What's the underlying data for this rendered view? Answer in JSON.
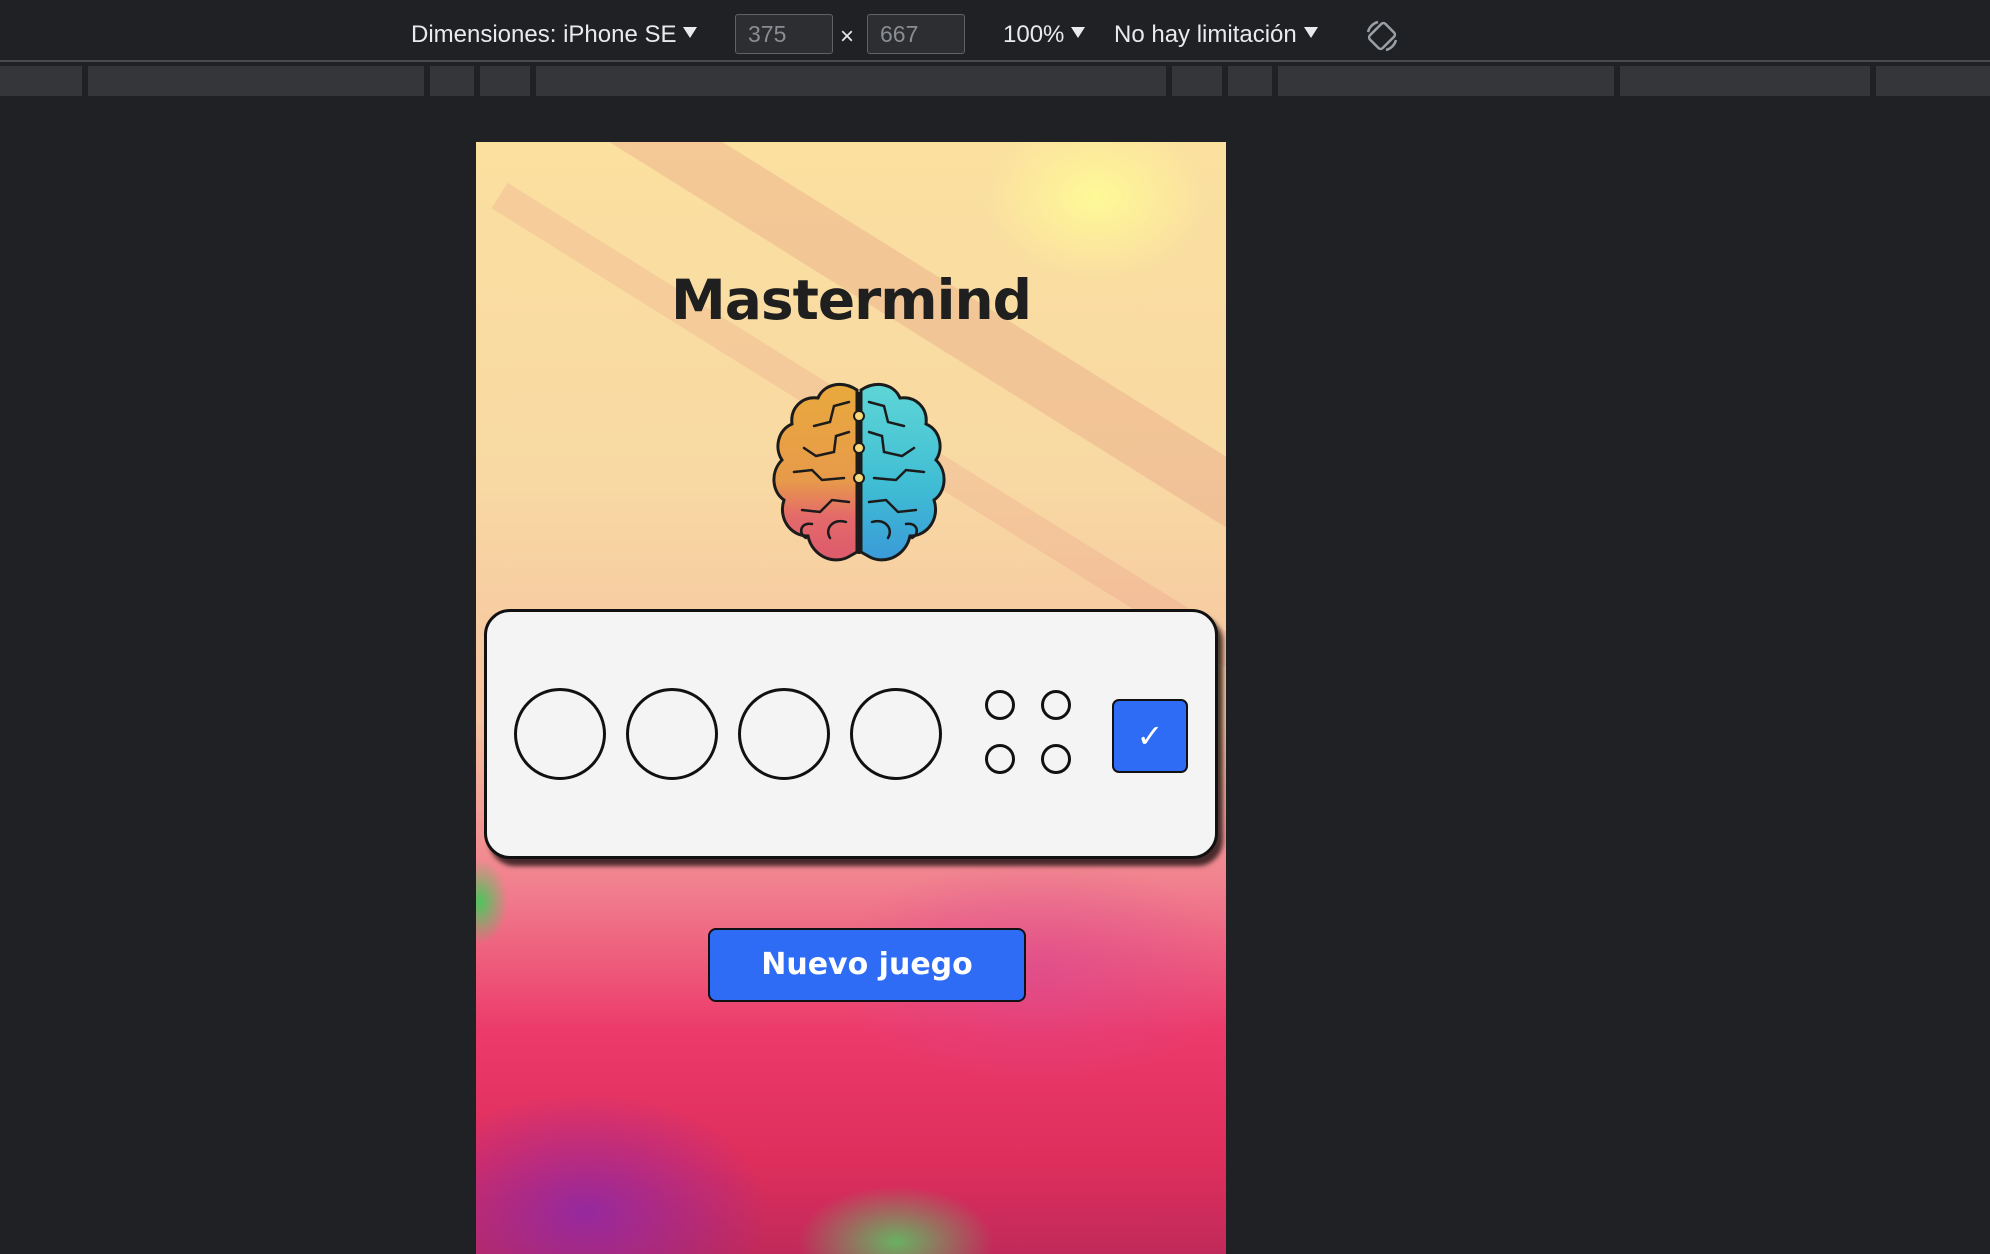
{
  "devtools": {
    "dimensions_label": "Dimensiones: iPhone SE",
    "width": "375",
    "times": "×",
    "height": "667",
    "zoom": "100%",
    "throttling": "No hay limitación",
    "rotate_icon": "rotate-icon"
  },
  "app": {
    "title": "Mastermind",
    "logo_icon": "brain-icon",
    "check_label": "✓",
    "new_game_label": "Nuevo juego"
  },
  "colors": {
    "accent": "#2f6cf5",
    "board": "#f4f4f4",
    "devtools_bg": "#202124"
  }
}
